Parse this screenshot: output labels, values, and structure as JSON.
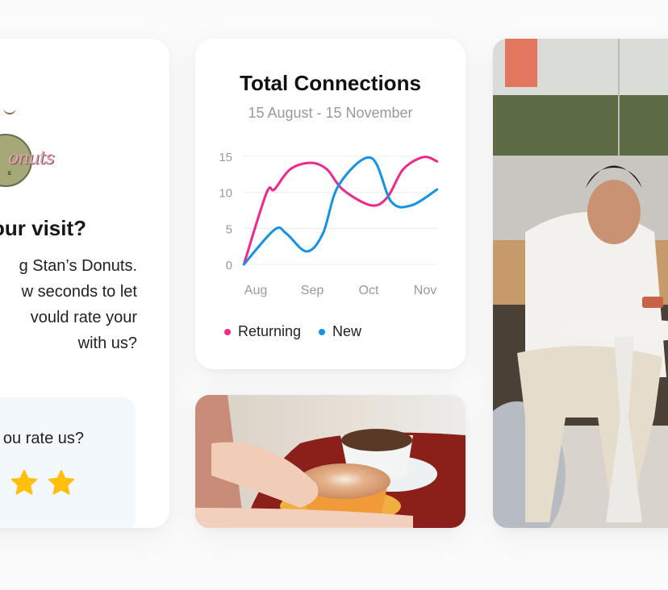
{
  "survey": {
    "logo_name": "Stan's Donuts",
    "logo_script": "onuts",
    "logo_tag": "E",
    "title": "our visit?",
    "body_lines": [
      "g Stan’s Donuts.",
      "w seconds to let",
      "vould rate your",
      "with us?"
    ],
    "rating_question": "ou rate us?",
    "rating": {
      "visible_stars_filled": 2,
      "star_color": "#ffbf0a"
    },
    "rate_box_color": "#f3f8fd"
  },
  "chart_card": {
    "title": "Total Connections",
    "subtitle": "15 August - 15 November"
  },
  "chart_data": {
    "type": "line",
    "title": "Total Connections",
    "subtitle": "15 August - 15 November",
    "xlabel": "",
    "ylabel": "",
    "x_ticks": [
      "Aug",
      "Sep",
      "Oct",
      "Nov"
    ],
    "y_ticks": [
      0,
      5,
      10,
      15
    ],
    "ylim": [
      0,
      15
    ],
    "xlim": [
      0,
      3.43
    ],
    "grid": true,
    "legend_placement": "bottom-left",
    "smooth": true,
    "series": [
      {
        "name": "Returning",
        "color": "#f0288c",
        "x": [
          -0.21,
          0.19,
          0.33,
          0.61,
          0.97,
          1.26,
          1.54,
          2.04,
          2.33,
          2.61,
          2.97,
          3.21
        ],
        "y": [
          0,
          9.9,
          10.4,
          13.2,
          14.1,
          13.2,
          10.4,
          8.2,
          9.3,
          13.2,
          14.9,
          14.3
        ]
      },
      {
        "name": "New",
        "color": "#1592e6",
        "x": [
          -0.21,
          0.33,
          0.54,
          0.9,
          1.19,
          1.47,
          2.04,
          2.4,
          2.76,
          3.21
        ],
        "y": [
          0,
          4.8,
          4.3,
          1.8,
          4.3,
          11.0,
          14.8,
          8.7,
          8.2,
          10.4
        ]
      }
    ]
  },
  "legend": [
    {
      "label": "Returning",
      "color": "#f0288c"
    },
    {
      "label": "New",
      "color": "#1592e6"
    }
  ],
  "photos": {
    "coffee": "coffee-cups-photo",
    "man": "man-with-phone-photo"
  }
}
